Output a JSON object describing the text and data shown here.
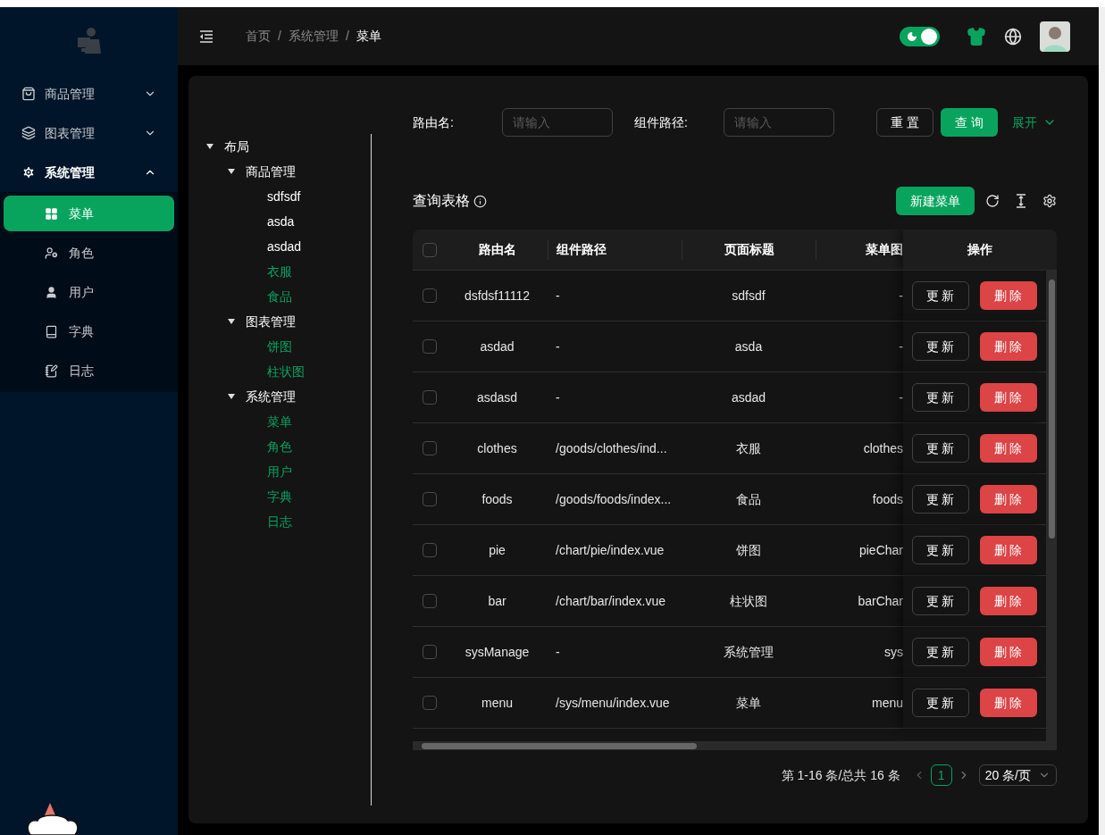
{
  "sidebar": {
    "menu": [
      {
        "label": "商品管理",
        "expanded": false
      },
      {
        "label": "图表管理",
        "expanded": false
      },
      {
        "label": "系统管理",
        "expanded": true,
        "children": [
          {
            "label": "菜单",
            "selected": true
          },
          {
            "label": "角色",
            "selected": false
          },
          {
            "label": "用户",
            "selected": false
          },
          {
            "label": "字典",
            "selected": false
          },
          {
            "label": "日志",
            "selected": false
          }
        ]
      }
    ]
  },
  "header": {
    "breadcrumb": [
      {
        "kind": "link",
        "text": "首页"
      },
      {
        "kind": "separator",
        "text": "/"
      },
      {
        "kind": "link",
        "text": "系统管理"
      },
      {
        "kind": "separator",
        "text": "/"
      },
      {
        "kind": "current",
        "text": "菜单"
      }
    ],
    "dark_mode": {
      "on": true
    }
  },
  "tree": [
    {
      "label": "布局",
      "expanded": true,
      "highlighted": false,
      "children": [
        {
          "label": "商品管理",
          "expanded": true,
          "highlighted": false,
          "children": [
            {
              "label": "sdfsdf",
              "highlighted": false
            },
            {
              "label": "asda",
              "highlighted": false
            },
            {
              "label": "asdad",
              "highlighted": false
            },
            {
              "label": "衣服",
              "highlighted": true
            },
            {
              "label": "食品",
              "highlighted": true
            }
          ]
        },
        {
          "label": "图表管理",
          "expanded": true,
          "highlighted": false,
          "children": [
            {
              "label": "饼图",
              "highlighted": true
            },
            {
              "label": "柱状图",
              "highlighted": true
            }
          ]
        },
        {
          "label": "系统管理",
          "expanded": true,
          "highlighted": false,
          "children": [
            {
              "label": "菜单",
              "highlighted": true
            },
            {
              "label": "角色",
              "highlighted": true
            },
            {
              "label": "用户",
              "highlighted": true
            },
            {
              "label": "字典",
              "highlighted": true
            },
            {
              "label": "日志",
              "highlighted": true
            }
          ]
        }
      ]
    }
  ],
  "search_form": {
    "fields": [
      {
        "label": "路由名:",
        "placeholder": "请输入"
      },
      {
        "label": "组件路径:",
        "placeholder": "请输入"
      }
    ],
    "reset_button": "重 置",
    "query_button": "查 询",
    "expand_link": "展开"
  },
  "table_title": "查询表格",
  "new_button": "新建菜单",
  "table": {
    "select_all": {
      "checked": false
    },
    "columns": [
      "路由名",
      "组件路径",
      "页面标题",
      "菜单图",
      "操作"
    ],
    "rows": [
      {
        "checked": false,
        "cells": [
          "dsfdsf11112",
          "-",
          "sdfsdf",
          "-"
        ],
        "update_button": "更 新",
        "delete_button": "删 除"
      },
      {
        "checked": false,
        "cells": [
          "asdad",
          "-",
          "asda",
          "-"
        ],
        "update_button": "更 新",
        "delete_button": "删 除"
      },
      {
        "checked": false,
        "cells": [
          "asdasd",
          "-",
          "asdad",
          "-"
        ],
        "update_button": "更 新",
        "delete_button": "删 除"
      },
      {
        "checked": false,
        "cells": [
          "clothes",
          "/goods/clothes/ind...",
          "衣服",
          "clothes"
        ],
        "update_button": "更 新",
        "delete_button": "删 除"
      },
      {
        "checked": false,
        "cells": [
          "foods",
          "/goods/foods/index...",
          "食品",
          "foods"
        ],
        "update_button": "更 新",
        "delete_button": "删 除"
      },
      {
        "checked": false,
        "cells": [
          "pie",
          "/chart/pie/index.vue",
          "饼图",
          "pieChar"
        ],
        "update_button": "更 新",
        "delete_button": "删 除"
      },
      {
        "checked": false,
        "cells": [
          "bar",
          "/chart/bar/index.vue",
          "柱状图",
          "barChar"
        ],
        "update_button": "更 新",
        "delete_button": "删 除"
      },
      {
        "checked": false,
        "cells": [
          "sysManage",
          "-",
          "系统管理",
          "sys"
        ],
        "update_button": "更 新",
        "delete_button": "删 除"
      },
      {
        "checked": false,
        "cells": [
          "menu",
          "/sys/menu/index.vue",
          "菜单",
          "menu"
        ],
        "update_button": "更 新",
        "delete_button": "删 除"
      }
    ]
  },
  "pagination": {
    "summary": "第 1-16 条/总共 16 条",
    "pages": [
      {
        "label": "1",
        "selected": true
      }
    ],
    "page_size": "20 条/页"
  }
}
